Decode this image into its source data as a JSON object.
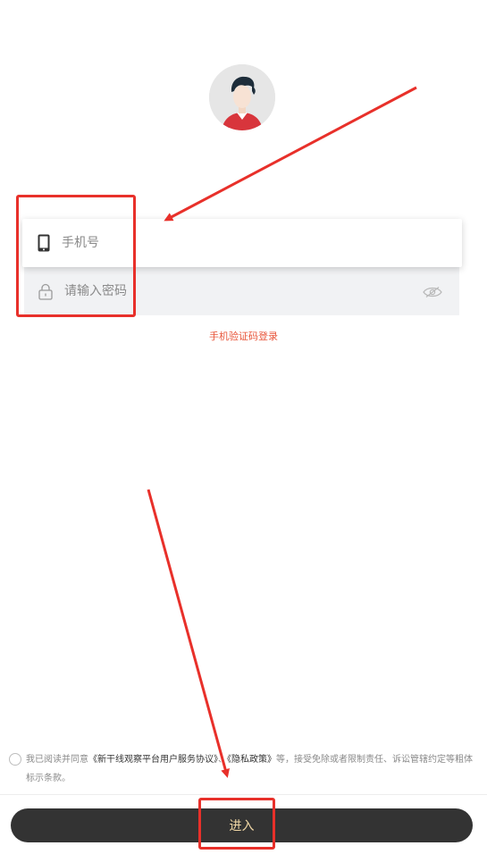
{
  "login": {
    "phone_placeholder": "手机号",
    "password_placeholder": "请输入密码",
    "sms_login_link": "手机验证码登录"
  },
  "agreement": {
    "prefix": "我已阅读并同意",
    "service_agreement": "《新干线观察平台用户服务协议》",
    "separator": "、",
    "privacy_policy": "《隐私政策》",
    "suffix": "等，接受免除或者限制责任、诉讼管辖约定等粗体标示条款。"
  },
  "footer": {
    "enter_label": "进入"
  },
  "colors": {
    "accent": "#e8553a",
    "button_bg": "#333333",
    "button_text": "#f2d8a6",
    "annotation": "#e8302a"
  },
  "icons": {
    "phone": "phone-icon",
    "lock": "lock-icon",
    "eye": "eye-hidden-icon"
  }
}
